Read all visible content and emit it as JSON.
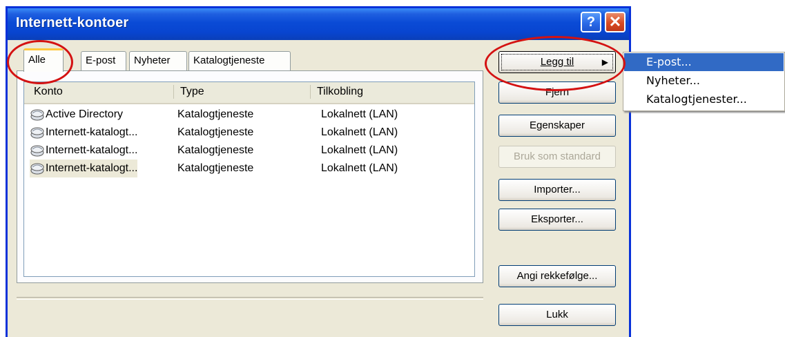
{
  "window": {
    "title": "Internett-kontoer",
    "help_label": "?",
    "close_label": "✕"
  },
  "tabs": [
    {
      "label": "Alle"
    },
    {
      "label": "E-post"
    },
    {
      "label": "Nyheter"
    },
    {
      "label": "Katalogtjeneste"
    }
  ],
  "list": {
    "columns": [
      "Konto",
      "Type",
      "Tilkobling"
    ],
    "rows": [
      {
        "account": "Active Directory",
        "type": "Katalogtjeneste",
        "connection": "Lokalnett (LAN)",
        "icon": "directory-service-icon"
      },
      {
        "account": "Internett-katalogt...",
        "type": "Katalogtjeneste",
        "connection": "Lokalnett (LAN)",
        "icon": "directory-service-icon"
      },
      {
        "account": "Internett-katalogt...",
        "type": "Katalogtjeneste",
        "connection": "Lokalnett (LAN)",
        "icon": "directory-service-icon"
      },
      {
        "account": "Internett-katalogt...",
        "type": "Katalogtjeneste",
        "connection": "Lokalnett (LAN)",
        "icon": "directory-service-icon"
      }
    ]
  },
  "buttons": {
    "add": "Legg til",
    "remove": "Fjern",
    "properties": "Egenskaper",
    "set_default": "Bruk som standard",
    "import": "Importer...",
    "export": "Eksporter...",
    "set_order": "Angi rekkefølge...",
    "close": "Lukk"
  },
  "add_menu": {
    "items": [
      "E-post...",
      "Nyheter...",
      "Katalogtjenester..."
    ]
  },
  "colors": {
    "titlebar": "#0a4bd6",
    "highlight": "#316ac5",
    "annotation": "#d41212"
  }
}
